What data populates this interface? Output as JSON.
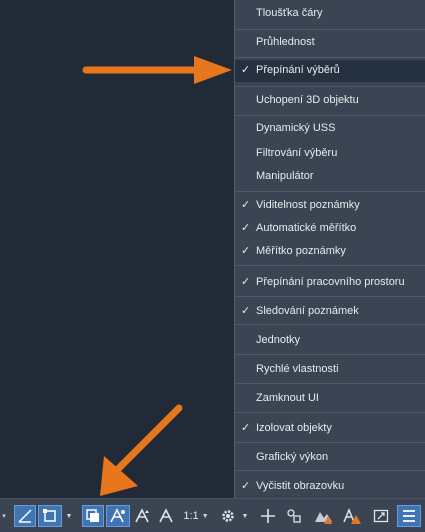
{
  "menu": {
    "items": [
      {
        "label": "Tloušťka čáry",
        "checked": false
      },
      {
        "label": "Průhlednost",
        "checked": false
      },
      {
        "label": "Přepínání výběrů",
        "checked": true
      },
      {
        "label": "Uchopení 3D objektu",
        "checked": false
      },
      {
        "label": "Dynamický USS",
        "checked": false
      },
      {
        "label": "Filtrování výběru",
        "checked": false
      },
      {
        "label": "Manipulátor",
        "checked": false
      },
      {
        "label": "Viditelnost poznámky",
        "checked": true
      },
      {
        "label": "Automatické měřítko",
        "checked": true
      },
      {
        "label": "Měřítko poznámky",
        "checked": true
      },
      {
        "label": "Přepínání pracovního prostoru",
        "checked": true
      },
      {
        "label": "Sledování poznámek",
        "checked": true
      },
      {
        "label": "Jednotky",
        "checked": false
      },
      {
        "label": "Rychlé vlastnosti",
        "checked": false
      },
      {
        "label": "Zamknout UI",
        "checked": false
      },
      {
        "label": "Izolovat objekty",
        "checked": true
      },
      {
        "label": "Grafický výkon",
        "checked": false
      },
      {
        "label": "Vyčistit obrazovku",
        "checked": true
      }
    ],
    "check_glyph": "✓"
  },
  "statusbar": {
    "scale_label": "1:1",
    "icons": [
      "ortho-icon",
      "selection-cycling-icon",
      "annotation-visibility-icon",
      "auto-scale-icon",
      "annotation-scale-icon",
      "gear-icon",
      "plus-icon",
      "units-icon",
      "quick-properties-icon",
      "isolate-objects-icon",
      "clean-screen-icon",
      "hamburger-menu-icon"
    ]
  },
  "colors": {
    "accent": "#3f74b5",
    "arrow": "#e8761c",
    "menu_bg": "#3a4453",
    "highlight": "#253040"
  }
}
